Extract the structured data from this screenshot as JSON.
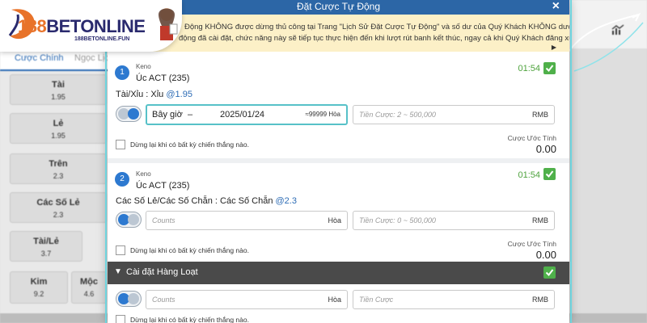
{
  "logo": {
    "num": "188",
    "brand": "BETONLINE",
    "sub": "188BETONLINE.FUN"
  },
  "background": {
    "tabs": [
      "Cược Chính",
      "Ngọc Lịch"
    ],
    "cells": [
      {
        "name": "Tài",
        "odds": "1.95"
      },
      {
        "name": "Lẻ",
        "odds": "1.95"
      },
      {
        "name": "Trên",
        "odds": "2.3"
      },
      {
        "name": "Các Số Lẻ",
        "odds": "2.3"
      },
      {
        "name": "Tài/Lẻ",
        "odds": "3.7"
      },
      {
        "name": "Kim",
        "odds": "9.2"
      },
      {
        "name": "Mộc",
        "odds": "4.6"
      }
    ]
  },
  "modal": {
    "title": "Đặt Cược Tự Động",
    "close": "×",
    "notice_lines": [
      "Động KHÔNG được dừng thủ công tại Trang \"Lịch Sử Đặt Cược Tự Động\" và số dư của Quý Khách KHÔNG dưới mức",
      "động đã cài đặt, chức năng này sẽ tiếp tục thực hiện đến khi lượt rút banh kết thúc, ngay cả khi Quý Khách đăng xuất tài"
    ],
    "notice_arrow": "▶",
    "bets": [
      {
        "index": "1",
        "game_type": "Keno",
        "game_name": "Úc ACT (235)",
        "timer": "01:54",
        "bet_label": "Tài/Xỉu : Xỉu",
        "odds": "@1.95",
        "draw_label": "Bây giờ",
        "draw_dash": "–",
        "draw_date": "2025/01/24",
        "draw_suffix": "≈99999 Hòa",
        "stake_placeholder": "Tiền Cược: 2 ~ 500,000",
        "stake_currency": "RMB",
        "stop_label": "Dừng lại khi có bất kỳ chiến thắng nào.",
        "est_label": "Cược Ước Tính",
        "est_value": "0.00"
      },
      {
        "index": "2",
        "game_type": "Keno",
        "game_name": "Úc ACT (235)",
        "timer": "01:54",
        "bet_label": "Các Số Lẻ/Các Số Chẵn : Các Số Chẵn",
        "odds": "@2.3",
        "counts_placeholder": "Counts",
        "counts_suffix": "Hòa",
        "stake_placeholder": "Tiền Cược: 0 ~ 500,000",
        "stake_currency": "RMB",
        "stop_label": "Dừng lại khi có bất kỳ chiến thắng nào.",
        "est_label": "Cược Ước Tính",
        "est_value": "0.00"
      }
    ],
    "batch": {
      "chevron": "▼",
      "label": "Cài đặt Hàng Loạt",
      "counts_placeholder": "Counts",
      "counts_suffix": "Hòa",
      "stake_placeholder": "Tiền Cược",
      "stake_currency": "RMB",
      "stop_label": "Dừng lại khi có bất kỳ chiến thắng nào."
    }
  },
  "colors": {
    "header": "#2c66a6",
    "notice": "#fcf0c7",
    "timer": "#4fa33e",
    "accent": "#2d79d0"
  }
}
